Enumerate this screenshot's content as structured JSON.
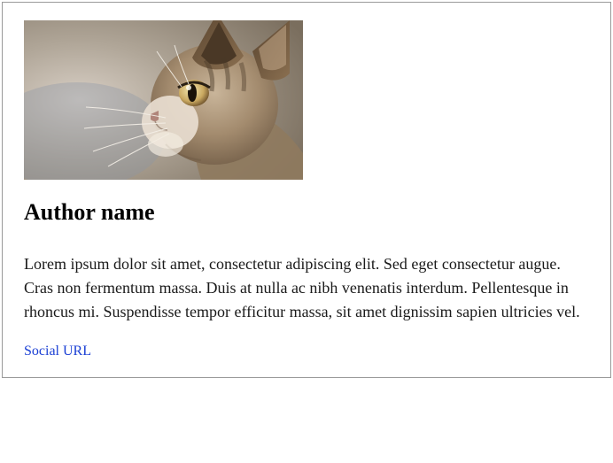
{
  "author": {
    "image_alt": "Author profile image of a cat",
    "name": "Author name",
    "bio": "Lorem ipsum dolor sit amet, consectetur adipiscing elit. Sed eget consectetur augue. Cras non fermentum massa. Duis at nulla ac nibh venenatis interdum. Pellentesque in rhoncus mi. Suspendisse tempor efficitur massa, sit amet dignissim sapien ultricies vel.",
    "social_label": "Social URL"
  }
}
